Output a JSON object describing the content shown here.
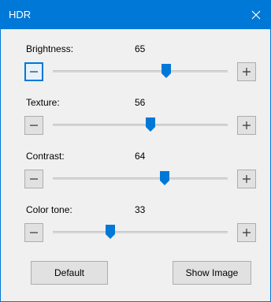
{
  "window": {
    "title": "HDR"
  },
  "sliders": [
    {
      "label": "Brightness:",
      "value": "65",
      "level": 65
    },
    {
      "label": "Texture:",
      "value": "56",
      "level": 56
    },
    {
      "label": "Contrast:",
      "value": "64",
      "level": 64
    },
    {
      "label": "Color tone:",
      "value": "33",
      "level": 33
    }
  ],
  "buttons": {
    "default_label": "Default",
    "show_image_label": "Show Image"
  },
  "colors": {
    "accent": "#0078d7",
    "background": "#f0f0f0",
    "button_face": "#e1e1e1"
  },
  "icons": {
    "close": "close-icon",
    "minus": "minus-icon",
    "plus": "plus-icon"
  }
}
